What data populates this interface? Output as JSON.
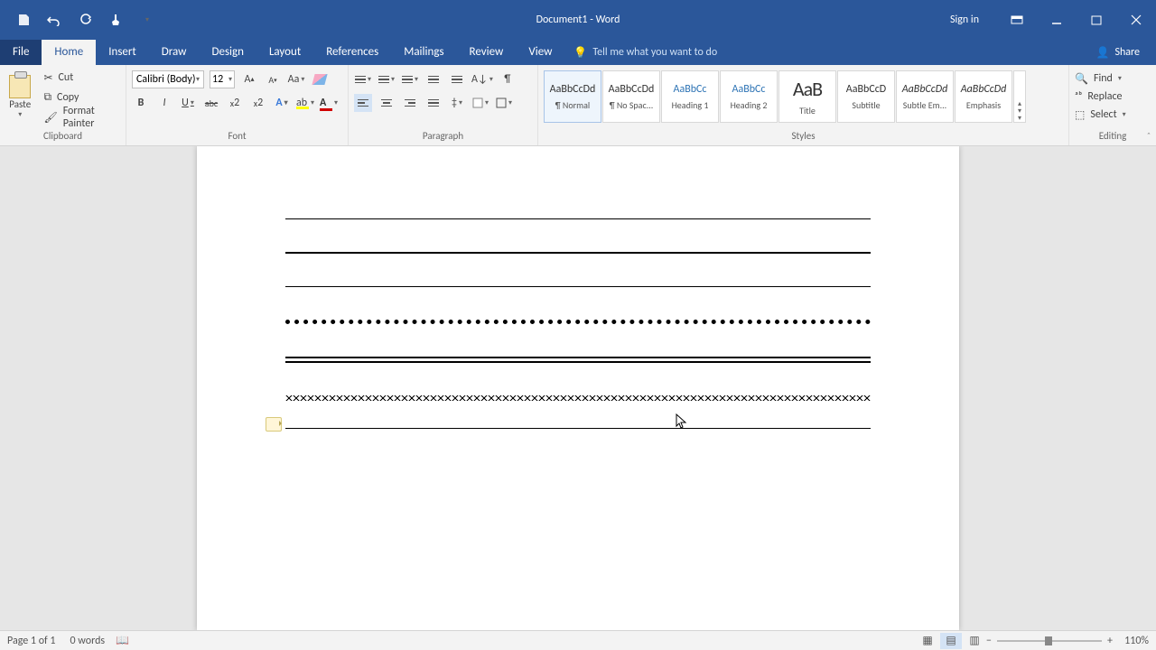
{
  "titlebar": {
    "title": "Document1 - Word",
    "signin": "Sign in"
  },
  "tabs": {
    "file": "File",
    "home": "Home",
    "insert": "Insert",
    "draw": "Draw",
    "design": "Design",
    "layout": "Layout",
    "references": "References",
    "mailings": "Mailings",
    "review": "Review",
    "view": "View",
    "tellme_placeholder": "Tell me what you want to do",
    "share": "Share"
  },
  "clipboard": {
    "paste": "Paste",
    "cut": "Cut",
    "copy": "Copy",
    "format_painter": "Format Painter",
    "label": "Clipboard"
  },
  "font": {
    "name": "Calibri (Body)",
    "size": "12",
    "label": "Font"
  },
  "paragraph": {
    "label": "Paragraph"
  },
  "styles": {
    "label": "Styles",
    "items": [
      {
        "preview": "AaBbCcDd",
        "name": "¶ Normal",
        "cls": ""
      },
      {
        "preview": "AaBbCcDd",
        "name": "¶ No Spac...",
        "cls": ""
      },
      {
        "preview": "AaBbCc",
        "name": "Heading 1",
        "cls": "hprev"
      },
      {
        "preview": "AaBbCc",
        "name": "Heading 2",
        "cls": "hprev"
      },
      {
        "preview": "AaB",
        "name": "Title",
        "cls": "titleprev"
      },
      {
        "preview": "AaBbCcD",
        "name": "Subtitle",
        "cls": ""
      },
      {
        "preview": "AaBbCcDd",
        "name": "Subtle Em...",
        "cls": "emph"
      },
      {
        "preview": "AaBbCcDd",
        "name": "Emphasis",
        "cls": "emph"
      }
    ]
  },
  "editing": {
    "find": "Find",
    "replace": "Replace",
    "select": "Select",
    "label": "Editing"
  },
  "status": {
    "page": "Page 1 of 1",
    "words": "0 words",
    "zoom": "110%"
  }
}
